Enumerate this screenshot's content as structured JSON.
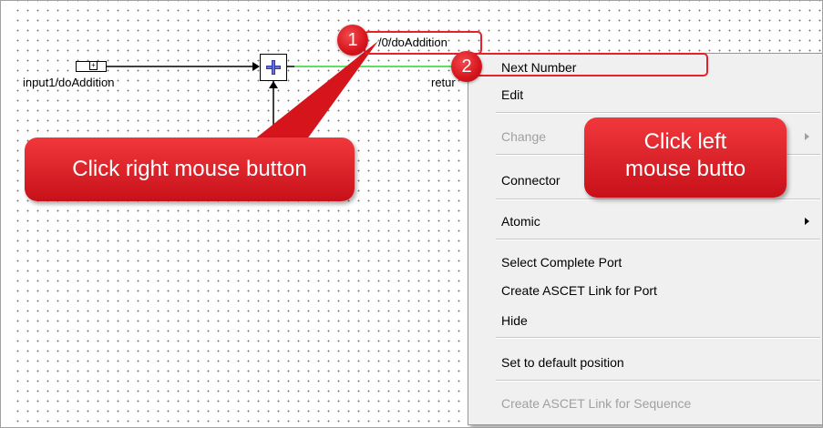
{
  "diagram": {
    "input_label": "input1/doAddition",
    "output_label_partial": "retur",
    "connector_label": "/0/doAddition",
    "input_block_glyph": "+",
    "plus_block_icon": "plus-icon"
  },
  "context_menu": {
    "items": [
      {
        "label": "Next Number",
        "enabled": true,
        "submenu": false
      },
      {
        "label": "Edit",
        "enabled": true,
        "submenu": false
      },
      {
        "label": "Change",
        "enabled": false,
        "submenu": true
      },
      {
        "label": "Connector",
        "enabled": true,
        "submenu": false
      },
      {
        "label": "Atomic",
        "enabled": true,
        "submenu": true
      },
      {
        "label": "Select Complete Port",
        "enabled": true,
        "submenu": false
      },
      {
        "label": "Create ASCET Link for Port",
        "enabled": true,
        "submenu": false
      },
      {
        "label": "Hide",
        "enabled": true,
        "submenu": false
      },
      {
        "label": "Set to default position",
        "enabled": true,
        "submenu": false
      },
      {
        "label": "Create ASCET Link for Sequence",
        "enabled": false,
        "submenu": false
      }
    ]
  },
  "annotations": {
    "badge1": "1",
    "badge2": "2",
    "callout_right_click": "Click right mouse button",
    "callout_left_click_line1": "Click left",
    "callout_left_click_line2": "mouse butto"
  },
  "colors": {
    "highlight": "#e8202a",
    "callout": "#d6141c",
    "active_wire": "#2bd62b",
    "menu_bg": "#f0f0f0"
  }
}
